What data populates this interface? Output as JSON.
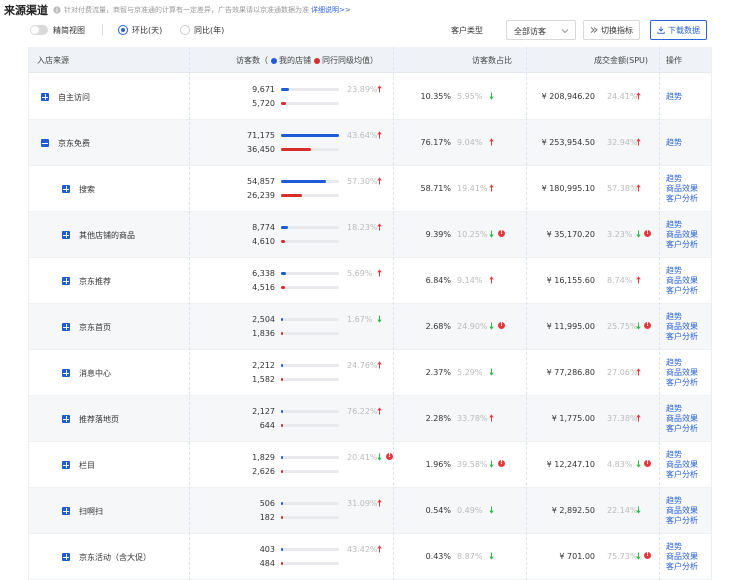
{
  "header": {
    "title": "来源渠道",
    "note": "针对付费流量，商智与京准通的计算有一定差异，广告效果请以京准通数据为准",
    "note_link": "详细说明>>"
  },
  "controls": {
    "compact_view_label": "精简视图",
    "compact_view_on": false,
    "compare_options": [
      "环比(天)",
      "同比(年)"
    ],
    "compare_selected": 0,
    "customer_type_label": "客户类型",
    "customer_type_value": "全部访客",
    "switch_metric_label": "切换指标",
    "download_label": "下载数据"
  },
  "table": {
    "columns": {
      "source": "入店来源",
      "visitors": "访客数（",
      "my_store": "我的店铺",
      "industry_avg": "同行同级均值）",
      "visitor_share": "访客数占比",
      "sales_amount": "成交金额(SPU)",
      "operation": "操作"
    },
    "rows": [
      {
        "name": "自主访问",
        "level": 0,
        "expanded": false,
        "my": "9,671",
        "my_val": 9671,
        "peer": "5,720",
        "peer_val": 5720,
        "pct": "23.89%",
        "pct_dir": "up",
        "pct_warn": false,
        "share": "10.35%",
        "share_chg": "5.95%",
        "share_dir": "down",
        "share_warn": false,
        "amount": "¥ 208,946.20",
        "amount_chg": "24.41%",
        "amount_dir": "up",
        "amount_warn": false,
        "ops": [
          "趋势"
        ]
      },
      {
        "name": "京东免费",
        "level": 0,
        "expanded": true,
        "my": "71,175",
        "my_val": 71175,
        "peer": "36,450",
        "peer_val": 36450,
        "pct": "43.64%",
        "pct_dir": "up",
        "pct_warn": false,
        "share": "76.17%",
        "share_chg": "9.04%",
        "share_dir": "up",
        "share_warn": false,
        "amount": "¥ 253,954.50",
        "amount_chg": "32.94%",
        "amount_dir": "up",
        "amount_warn": false,
        "ops": [
          "趋势"
        ]
      },
      {
        "name": "搜索",
        "level": 1,
        "expanded": false,
        "my": "54,857",
        "my_val": 54857,
        "peer": "26,239",
        "peer_val": 26239,
        "pct": "57.30%",
        "pct_dir": "up",
        "pct_warn": false,
        "share": "58.71%",
        "share_chg": "19.41%",
        "share_dir": "up",
        "share_warn": false,
        "amount": "¥ 180,995.10",
        "amount_chg": "57.38%",
        "amount_dir": "up",
        "amount_warn": false,
        "ops": [
          "趋势",
          "商品效果",
          "客户分析"
        ]
      },
      {
        "name": "其他店铺的商品",
        "level": 1,
        "expanded": false,
        "my": "8,774",
        "my_val": 8774,
        "peer": "4,610",
        "peer_val": 4610,
        "pct": "18.23%",
        "pct_dir": "up",
        "pct_warn": false,
        "share": "9.39%",
        "share_chg": "10.25%",
        "share_dir": "down",
        "share_warn": true,
        "amount": "¥ 35,170.20",
        "amount_chg": "3.23%",
        "amount_dir": "down",
        "amount_warn": true,
        "ops": [
          "趋势",
          "商品效果",
          "客户分析"
        ]
      },
      {
        "name": "京东推荐",
        "level": 1,
        "expanded": false,
        "my": "6,338",
        "my_val": 6338,
        "peer": "4,516",
        "peer_val": 4516,
        "pct": "5.69%",
        "pct_dir": "up",
        "pct_warn": false,
        "share": "6.84%",
        "share_chg": "9.14%",
        "share_dir": "up",
        "share_warn": false,
        "amount": "¥ 16,155.60",
        "amount_chg": "8.74%",
        "amount_dir": "up",
        "amount_warn": false,
        "ops": [
          "趋势",
          "商品效果",
          "客户分析"
        ]
      },
      {
        "name": "京东首页",
        "level": 1,
        "expanded": false,
        "my": "2,504",
        "my_val": 2504,
        "peer": "1,836",
        "peer_val": 1836,
        "pct": "1.67%",
        "pct_dir": "down",
        "pct_warn": false,
        "share": "2.68%",
        "share_chg": "24.90%",
        "share_dir": "down",
        "share_warn": true,
        "amount": "¥ 11,995.00",
        "amount_chg": "25.75%",
        "amount_dir": "down",
        "amount_warn": true,
        "ops": [
          "趋势",
          "商品效果",
          "客户分析"
        ]
      },
      {
        "name": "消息中心",
        "level": 1,
        "expanded": false,
        "my": "2,212",
        "my_val": 2212,
        "peer": "1,582",
        "peer_val": 1582,
        "pct": "24.76%",
        "pct_dir": "up",
        "pct_warn": false,
        "share": "2.37%",
        "share_chg": "5.29%",
        "share_dir": "down",
        "share_warn": false,
        "amount": "¥ 77,286.80",
        "amount_chg": "27.06%",
        "amount_dir": "up",
        "amount_warn": false,
        "ops": [
          "趋势",
          "商品效果",
          "客户分析"
        ]
      },
      {
        "name": "推荐落地页",
        "level": 1,
        "expanded": false,
        "my": "2,127",
        "my_val": 2127,
        "peer": "644",
        "peer_val": 644,
        "pct": "76.22%",
        "pct_dir": "up",
        "pct_warn": false,
        "share": "2.28%",
        "share_chg": "33.78%",
        "share_dir": "up",
        "share_warn": false,
        "amount": "¥ 1,775.00",
        "amount_chg": "37.38%",
        "amount_dir": "up",
        "amount_warn": false,
        "ops": [
          "趋势",
          "商品效果",
          "客户分析"
        ]
      },
      {
        "name": "栏目",
        "level": 1,
        "expanded": false,
        "my": "1,829",
        "my_val": 1829,
        "peer": "2,626",
        "peer_val": 2626,
        "pct": "20.41%",
        "pct_dir": "down",
        "pct_warn": true,
        "share": "1.96%",
        "share_chg": "39.58%",
        "share_dir": "down",
        "share_warn": true,
        "amount": "¥ 12,247.10",
        "amount_chg": "4.83%",
        "amount_dir": "down",
        "amount_warn": true,
        "ops": [
          "趋势",
          "商品效果",
          "客户分析"
        ]
      },
      {
        "name": "扫啊扫",
        "level": 1,
        "expanded": false,
        "my": "506",
        "my_val": 506,
        "peer": "182",
        "peer_val": 182,
        "pct": "31.09%",
        "pct_dir": "up",
        "pct_warn": false,
        "share": "0.54%",
        "share_chg": "0.49%",
        "share_dir": "down",
        "share_warn": false,
        "amount": "¥ 2,892.50",
        "amount_chg": "22.14%",
        "amount_dir": "down",
        "amount_warn": false,
        "ops": [
          "趋势",
          "商品效果",
          "客户分析"
        ]
      },
      {
        "name": "京东活动（含大促）",
        "level": 1,
        "expanded": false,
        "my": "403",
        "my_val": 403,
        "peer": "484",
        "peer_val": 484,
        "pct": "43.42%",
        "pct_dir": "up",
        "pct_warn": false,
        "share": "0.43%",
        "share_chg": "8.87%",
        "share_dir": "down",
        "share_warn": false,
        "amount": "¥ 701.00",
        "amount_chg": "75.73%",
        "amount_dir": "down",
        "amount_warn": true,
        "ops": [
          "趋势",
          "商品效果",
          "客户分析"
        ]
      }
    ]
  },
  "colors": {
    "accent": "#2a63d4",
    "my_store_bar": "#1f5bd6",
    "industry_bar": "#d92c2c",
    "up_arrow": "#e4393c",
    "down_arrow": "#2eb84a"
  }
}
